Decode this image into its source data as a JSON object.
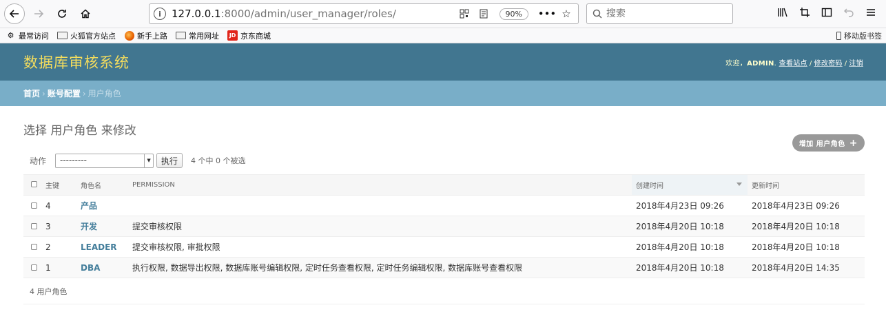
{
  "browser": {
    "url_host": "127.0.0.1",
    "url_rest": ":8000/admin/user_manager/roles/",
    "zoom": "90%",
    "search_placeholder": "搜索",
    "bookmarks": [
      {
        "label": "最常访问",
        "icon": "gear-icon"
      },
      {
        "label": "火狐官方站点",
        "icon": "folder-icon"
      },
      {
        "label": "新手上路",
        "icon": "firefox-icon"
      },
      {
        "label": "常用网址",
        "icon": "folder-icon"
      },
      {
        "label": "京东商城",
        "icon": "jd-icon"
      }
    ],
    "mobile_bookmarks": "移动版书签"
  },
  "header": {
    "site_name": "数据库审核系统",
    "welcome": "欢迎，",
    "username": "ADMIN",
    "view_site": "查看站点",
    "change_password": "修改密码",
    "logout": "注销",
    "sep": "/"
  },
  "breadcrumbs": {
    "home": "首页",
    "section": "账号配置",
    "current": "用户角色",
    "arrow": "›"
  },
  "page": {
    "title": "选择 用户角色 来修改",
    "add_button": "增加 用户角色"
  },
  "actions": {
    "label": "动作",
    "selected_option": "---------",
    "go_button": "执行",
    "counter": "4 个中 0 个被选"
  },
  "table": {
    "headers": {
      "id": "主键",
      "name": "角色名",
      "permission": "PERMISSION",
      "created": "创建时间",
      "updated": "更新时间"
    },
    "rows": [
      {
        "id": "4",
        "name": "产品",
        "permission": "",
        "created": "2018年4月23日 09:26",
        "updated": "2018年4月23日 09:26"
      },
      {
        "id": "3",
        "name": "开发",
        "permission": "提交审核权限",
        "created": "2018年4月20日 10:18",
        "updated": "2018年4月20日 10:18"
      },
      {
        "id": "2",
        "name": "LEADER",
        "permission": "提交审核权限, 审批权限",
        "created": "2018年4月20日 10:18",
        "updated": "2018年4月20日 10:18"
      },
      {
        "id": "1",
        "name": "DBA",
        "permission": "执行权限, 数据导出权限, 数据库账号编辑权限, 定时任务查看权限, 定时任务编辑权限, 数据库账号查看权限",
        "created": "2018年4月20日 10:18",
        "updated": "2018年4月20日 14:35"
      }
    ]
  },
  "paginator": "4 用户角色"
}
